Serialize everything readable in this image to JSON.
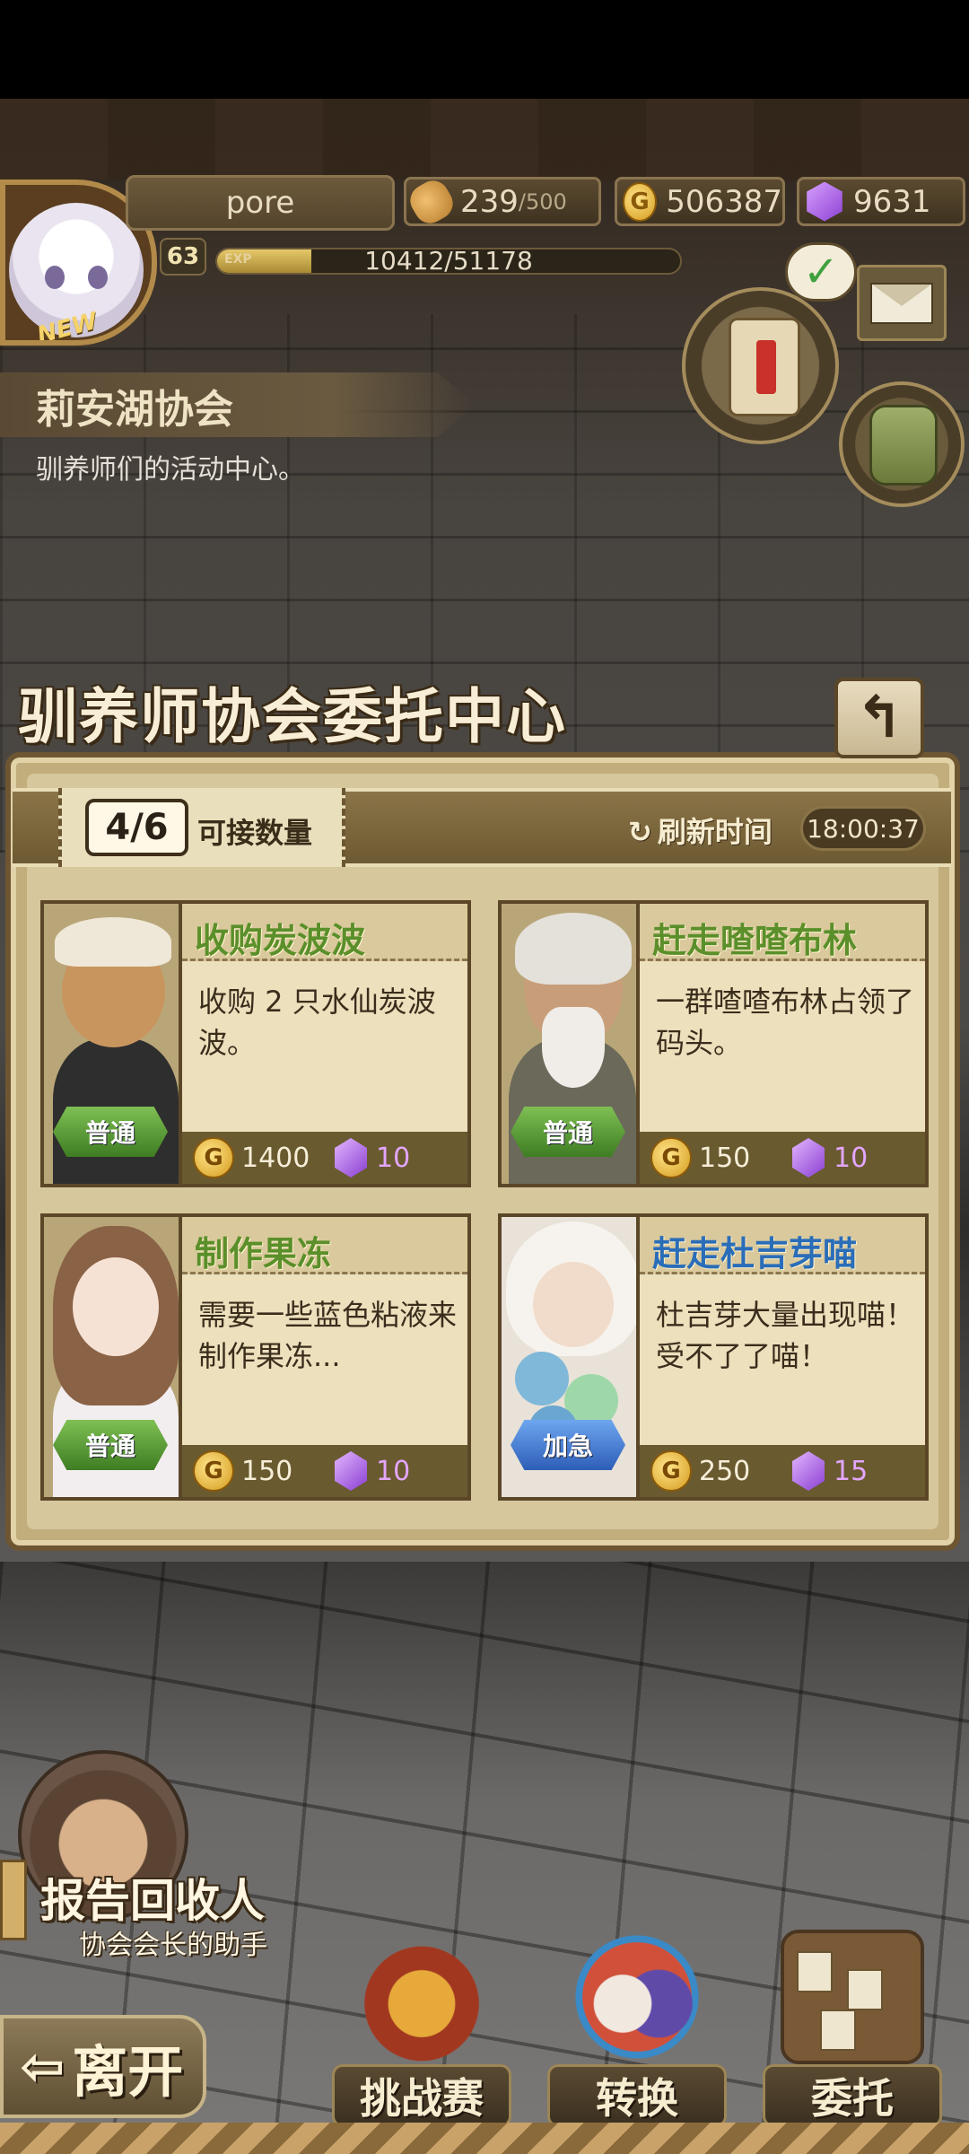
{
  "player": {
    "name": "pore",
    "level": "63",
    "avatar_badge": "NEW",
    "exp_label": "EXP",
    "exp_text": "10412/51178",
    "exp_fraction": 0.2034
  },
  "resources": {
    "stamina_current": "239",
    "stamina_max": "/500",
    "gold": "506387",
    "gems": "9631"
  },
  "location": {
    "name": "莉安湖协会",
    "description": "驯养师们的活动中心。"
  },
  "panel": {
    "title": "驯养师协会委托中心",
    "back_icon": "↰",
    "accept_count": "4/6",
    "accept_label": "可接数量",
    "refresh_icon": "↻",
    "refresh_label": "刷新时间",
    "refresh_time": "18:00:37"
  },
  "quests": [
    {
      "title": "收购炭波波",
      "description": "收购 2 只水仙炭波波。",
      "gold": "1400",
      "gems": "10",
      "difficulty": "普通",
      "title_color": "#5a8f2a"
    },
    {
      "title": "赶走喳喳布林",
      "description": "一群喳喳布林占领了码头。",
      "gold": "150",
      "gems": "10",
      "difficulty": "普通",
      "title_color": "#5a8f2a"
    },
    {
      "title": "制作果冻",
      "description": "需要一些蓝色粘液来制作果冻...",
      "gold": "150",
      "gems": "10",
      "difficulty": "普通",
      "title_color": "#5a8f2a"
    },
    {
      "title": "赶走杜吉芽喵",
      "description": "杜吉芽大量出现喵！受不了了喵！",
      "gold": "250",
      "gems": "15",
      "difficulty": "加急",
      "title_color": "#2a6db8"
    }
  ],
  "coin_glyph": "G",
  "helper": {
    "name": "报告回收人",
    "role": "协会会长的助手"
  },
  "bottom_nav": {
    "leave_arrow": "⇦",
    "leave_label": "离开",
    "challenge_label": "挑战赛",
    "convert_label": "转换",
    "commission_label": "委托"
  },
  "icons": [
    "bread-icon",
    "gold-coin-icon",
    "gem-icon",
    "quest-scroll-icon",
    "check-icon",
    "mail-icon",
    "backpack-icon",
    "refresh-icon",
    "back-arrow-icon"
  ]
}
